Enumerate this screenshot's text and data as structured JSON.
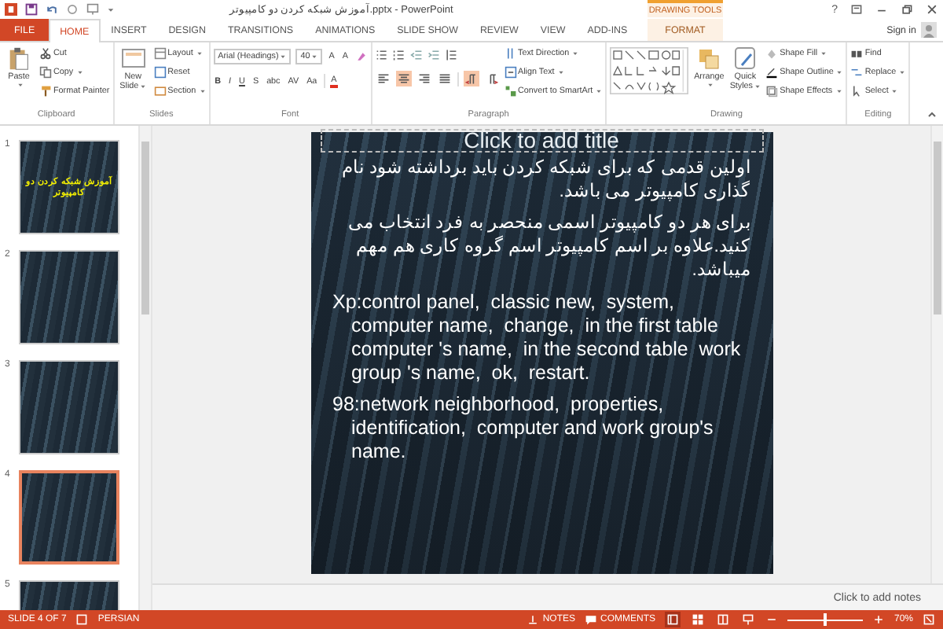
{
  "window": {
    "title": "آموزش شبکه کردن دو کامپیوتر.pptx - PowerPoint",
    "contextual_label": "DRAWING TOOLS",
    "help": "?",
    "sign_in": "Sign in"
  },
  "tabs": [
    {
      "label": "FILE",
      "kind": "file",
      "selected": false
    },
    {
      "label": "HOME",
      "kind": "tab",
      "selected": true
    },
    {
      "label": "INSERT",
      "kind": "tab",
      "selected": false
    },
    {
      "label": "DESIGN",
      "kind": "tab",
      "selected": false
    },
    {
      "label": "TRANSITIONS",
      "kind": "tab",
      "selected": false
    },
    {
      "label": "ANIMATIONS",
      "kind": "tab",
      "selected": false
    },
    {
      "label": "SLIDE SHOW",
      "kind": "tab",
      "selected": false
    },
    {
      "label": "REVIEW",
      "kind": "tab",
      "selected": false
    },
    {
      "label": "VIEW",
      "kind": "tab",
      "selected": false
    },
    {
      "label": "ADD-INS",
      "kind": "tab",
      "selected": false
    },
    {
      "label": "FORMAT",
      "kind": "contextual",
      "selected": false
    }
  ],
  "ribbon": {
    "clipboard": {
      "label": "Clipboard",
      "paste": "Paste",
      "cut": "Cut",
      "copy": "Copy",
      "format_painter": "Format Painter"
    },
    "slides": {
      "label": "Slides",
      "new_slide": "New Slide",
      "layout": "Layout",
      "reset": "Reset",
      "section": "Section"
    },
    "font": {
      "label": "Font",
      "name": "Arial (Headings)",
      "size": "40",
      "size_buttons": [
        "A",
        "A"
      ],
      "style_buttons": [
        "B",
        "I",
        "U",
        "S",
        "abc",
        "AV",
        "Aa"
      ],
      "color_button": "A"
    },
    "paragraph": {
      "label": "Paragraph",
      "alignments": [
        {
          "selected": false
        },
        {
          "selected": true
        },
        {
          "selected": false
        },
        {
          "selected": false
        }
      ],
      "directions": [
        {
          "selected": true
        },
        {
          "selected": false
        }
      ],
      "text_direction": "Text Direction",
      "align_text": "Align Text",
      "convert": "Convert to SmartArt"
    },
    "drawing": {
      "label": "Drawing",
      "arrange": "Arrange",
      "quick_styles": "Quick Styles",
      "shape_fill": "Shape Fill",
      "shape_outline": "Shape Outline",
      "shape_effects": "Shape Effects"
    },
    "editing": {
      "label": "Editing",
      "find": "Find",
      "replace": "Replace",
      "select": "Select"
    }
  },
  "slides": [
    {
      "number": "1",
      "selected": false,
      "title": "آموزش شبکه کردن دو کامپیوتر"
    },
    {
      "number": "2",
      "selected": false
    },
    {
      "number": "3",
      "selected": false
    },
    {
      "number": "4",
      "selected": true
    },
    {
      "number": "5",
      "selected": false
    }
  ],
  "slide": {
    "title_placeholder": "Click to add title",
    "paragraphs": [
      {
        "kind": "rtl",
        "text": "اولین قدمی که برای شبکه کردن باید برداشته شود نام گذاری کامپیوتر می باشد."
      },
      {
        "kind": "rtl",
        "text": "برای هر دو کامپیوتر اسمی منحصر به فرد انتخاب می کنید.علاوه بر اسم کامپیوتر اسم گروه کاری هم مهم میباشد."
      },
      {
        "kind": "ltr",
        "text": "Xp:control panel,  classic new,  system,  computer name,  change,  in the first table  computer 's name,  in the second table  work group 's name,  ok,  restart."
      },
      {
        "kind": "ltr",
        "text": "98:network neighborhood,  properties,  identification,  computer and work group's name."
      }
    ]
  },
  "notes": {
    "placeholder": "Click to add notes"
  },
  "status_bar": {
    "slide_info": "SLIDE 4 OF 7",
    "language": "PERSIAN",
    "notes": "NOTES",
    "comments": "COMMENTS",
    "views": [
      {
        "selected": true
      },
      {
        "selected": false
      },
      {
        "selected": false
      },
      {
        "selected": false
      }
    ],
    "zoom": {
      "level": 0.5
    },
    "zoom_label": "70%"
  }
}
